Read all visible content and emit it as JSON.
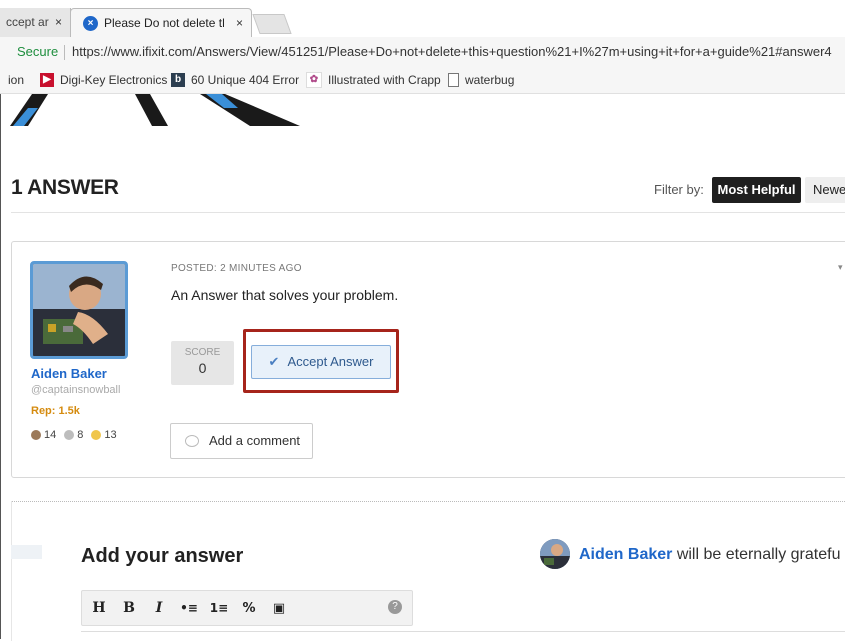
{
  "browser": {
    "tabs": [
      {
        "label": "ccept ar",
        "close": "×"
      },
      {
        "label": "Please Do not delete this",
        "close": "×",
        "favicon": "×"
      }
    ],
    "address": {
      "secure_label": "Secure",
      "url": "https://www.ifixit.com/Answers/View/451251/Please+Do+not+delete+this+question%21+I%27m+using+it+for+a+guide%21#answer4"
    },
    "bookmarks": [
      {
        "label": "ion",
        "icon": "none"
      },
      {
        "label": "Digi-Key Electronics",
        "icon": "digikey-icon"
      },
      {
        "label": "60 Unique 404 Error",
        "icon": "b-icon"
      },
      {
        "label": "Illustrated with Crapp",
        "icon": "illustrated-icon"
      },
      {
        "label": "waterbug",
        "icon": "page-icon"
      }
    ]
  },
  "answers": {
    "count_title": "1 ANSWER",
    "filter_label": "Filter by:",
    "filter_options": [
      "Most Helpful",
      "Newe"
    ]
  },
  "answer": {
    "author_name": "Aiden Baker",
    "author_handle": "@captainsnowball",
    "rep": "Rep: 1.5k",
    "badges": [
      {
        "count": "14",
        "color": "#9c7a5a"
      },
      {
        "count": "8",
        "color": "#bdbdbd"
      },
      {
        "count": "13",
        "color": "#f0c64b"
      }
    ],
    "posted": "POSTED: 2 MINUTES AGO",
    "text": "An Answer that solves your problem.",
    "score_label": "SCORE",
    "score_value": "0",
    "accept_label": "Accept Answer",
    "comment_label": "Add a comment"
  },
  "add_answer": {
    "title": "Add your answer",
    "grateful_name": "Aiden Baker",
    "grateful_text": " will be eternally gratefu",
    "toolbar": [
      "H",
      "B",
      "I",
      "•≡",
      "1≡",
      "%",
      "▣"
    ],
    "help": "?"
  },
  "colors": {
    "accent": "#1f67c9",
    "highlight": "#a6241b",
    "rep": "#d58b0f"
  }
}
